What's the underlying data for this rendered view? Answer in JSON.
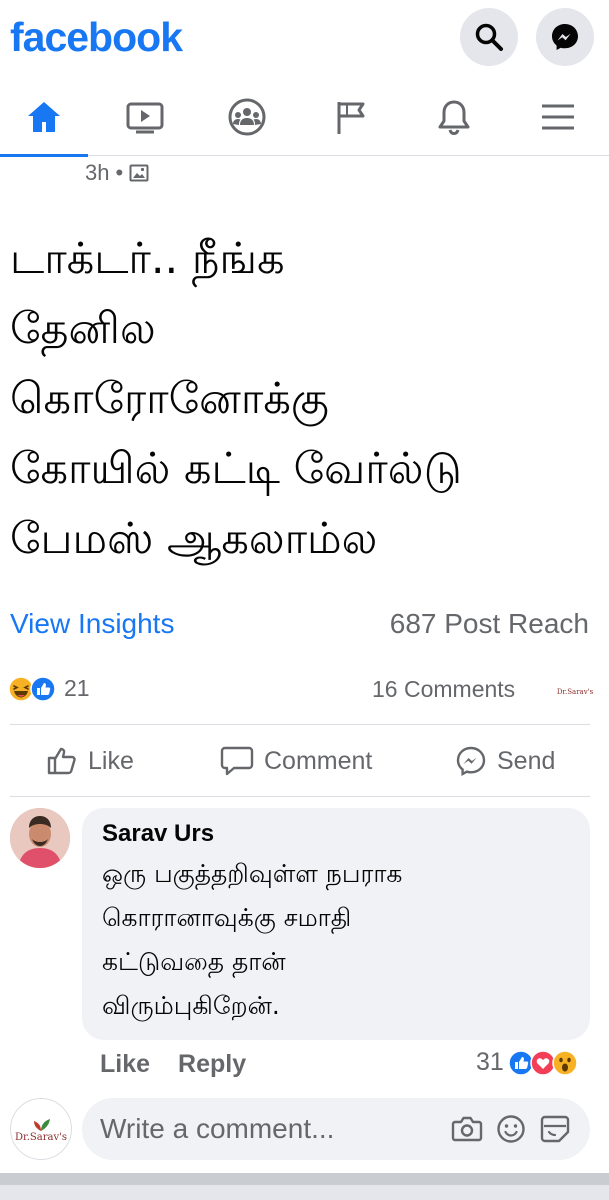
{
  "app": {
    "logo_text": "facebook",
    "brand_color": "#1877f2"
  },
  "header": {
    "buttons": [
      {
        "name": "search",
        "icon": "search-icon"
      },
      {
        "name": "messenger",
        "icon": "messenger-icon"
      }
    ]
  },
  "nav": {
    "tabs": [
      {
        "name": "home",
        "icon": "home-icon",
        "active": true
      },
      {
        "name": "watch",
        "icon": "video-icon",
        "active": false
      },
      {
        "name": "groups",
        "icon": "groups-icon",
        "active": false
      },
      {
        "name": "pages",
        "icon": "flag-icon",
        "active": false
      },
      {
        "name": "notifications",
        "icon": "bell-icon",
        "active": false
      },
      {
        "name": "menu",
        "icon": "hamburger-menu-icon",
        "active": false
      }
    ]
  },
  "post": {
    "time": "3h",
    "audience_icon": "photo-icon",
    "text_lines": [
      "டாக்டர்.. நீங்க",
      "தேனில",
      "கொரோனோக்கு",
      "கோயில் கட்டி வேர்ல்டு",
      "பேமஸ் ஆகலாம்ல"
    ],
    "view_insights": "View Insights",
    "post_reach": "687 Post Reach",
    "reactions_count": "21",
    "reaction_icons": [
      "haha-icon",
      "like-icon"
    ],
    "comments_count": "16 Comments",
    "page_avatar_text": "Dr.Sarav's",
    "actions": {
      "like": "Like",
      "comment": "Comment",
      "send": "Send"
    }
  },
  "comment": {
    "author": "Sarav Urs",
    "text_lines": [
      "ஒரு பகுத்தறிவுள்ள நபராக",
      "கொரானாவுக்கு சமாதி",
      "கட்டுவதை தான்",
      "விரும்புகிறேன்."
    ],
    "like_label": "Like",
    "reply_label": "Reply",
    "reaction_count": "31",
    "reaction_icons": [
      "like-icon",
      "love-icon",
      "wow-icon"
    ]
  },
  "composer": {
    "placeholder": "Write a comment...",
    "avatar_text": "Dr.Sarav's",
    "icons": [
      "camera-icon",
      "emoji-icon",
      "sticker-icon"
    ]
  }
}
